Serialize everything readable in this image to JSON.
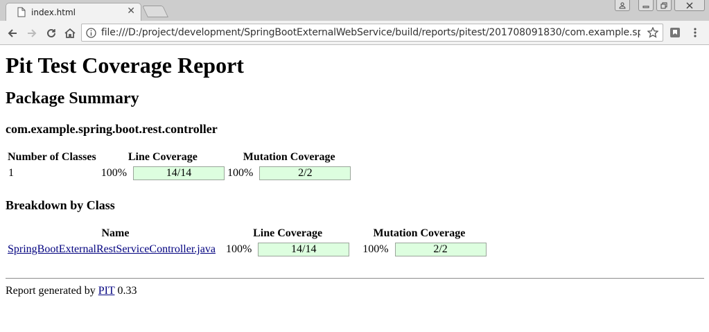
{
  "browser": {
    "tab_title": "index.html",
    "url": "file:///D:/project/development/SpringBootExternalWebService/build/reports/pitest/201708091830/com.example.spring.boot..."
  },
  "page": {
    "title": "Pit Test Coverage Report",
    "subtitle": "Package Summary",
    "package_name": "com.example.spring.boot.rest.controller",
    "summary_table": {
      "headers": [
        "Number of Classes",
        "Line Coverage",
        "Mutation Coverage"
      ],
      "num_classes": "1",
      "line_pct": "100%",
      "line_ratio": "14/14",
      "line_fill": 1.0,
      "mutation_pct": "100%",
      "mutation_ratio": "2/2",
      "mutation_fill": 1.0
    },
    "breakdown_heading": "Breakdown by Class",
    "breakdown_table": {
      "headers": [
        "Name",
        "Line Coverage",
        "Mutation Coverage"
      ],
      "rows": [
        {
          "name": "SpringBootExternalRestServiceController.java",
          "line_pct": "100%",
          "line_ratio": "14/14",
          "mutation_pct": "100%",
          "mutation_ratio": "2/2"
        }
      ]
    },
    "footer": {
      "prefix": "Report generated by ",
      "link": "PIT",
      "version": " 0.33"
    }
  },
  "colors": {
    "coverage_fill": "#ddfedf",
    "link": "#00007f"
  }
}
